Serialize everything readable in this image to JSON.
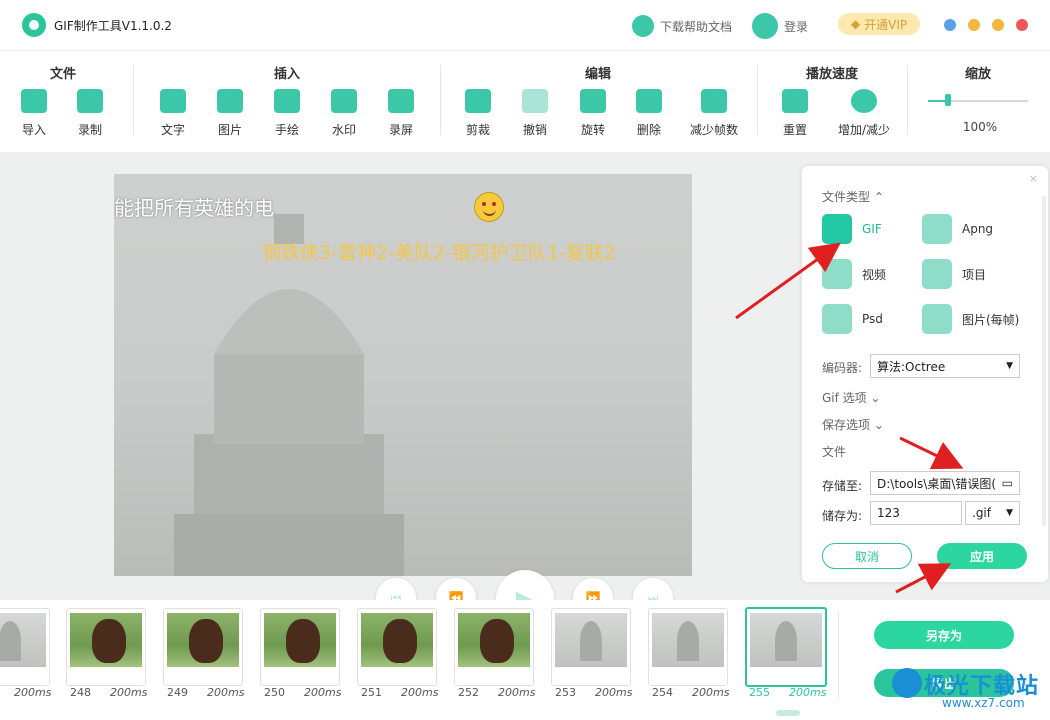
{
  "app": {
    "title": "GIF制作工具V1.1.0.2",
    "help": "下载帮助文档",
    "login": "登录",
    "vip": "开通VIP"
  },
  "toolbar": {
    "groups": [
      {
        "title": "文件",
        "items": [
          "导入",
          "录制"
        ]
      },
      {
        "title": "插入",
        "items": [
          "文字",
          "图片",
          "手绘",
          "水印",
          "录屏"
        ]
      },
      {
        "title": "编辑",
        "items": [
          "剪裁",
          "撤销",
          "旋转",
          "删除",
          "减少帧数"
        ]
      },
      {
        "title": "播放速度",
        "items": [
          "重置",
          "增加/减少"
        ]
      },
      {
        "title": "缩放",
        "items": []
      }
    ],
    "zoom": {
      "value": "100%",
      "level": 0.2
    }
  },
  "canvas": {
    "text1": "能把所有英雄的电",
    "text2": "钢铁侠3-雷神2-美队2-银河护卫队1-复联2"
  },
  "panel": {
    "file_type_label": "文件类型",
    "types": [
      "GIF",
      "Apng",
      "视频",
      "项目",
      "Psd",
      "图片(每帧)"
    ],
    "selected_type": "GIF",
    "encoder_label": "编码器:",
    "encoder_value": "算法:Octree",
    "gif_options": "Gif 选项",
    "save_options": "保存选项",
    "file_label": "文件",
    "save_to_label": "存储至:",
    "save_to_value": "D:\\tools\\桌面\\错误图(",
    "save_as_label": "储存为:",
    "save_as_value": "123",
    "ext_value": ".gif",
    "cancel": "取消",
    "apply": "应用"
  },
  "frames": [
    {
      "num": "",
      "dur": "200ms",
      "kind": "capitol"
    },
    {
      "num": "248",
      "dur": "200ms",
      "kind": "face"
    },
    {
      "num": "249",
      "dur": "200ms",
      "kind": "face"
    },
    {
      "num": "250",
      "dur": "200ms",
      "kind": "face"
    },
    {
      "num": "251",
      "dur": "200ms",
      "kind": "face"
    },
    {
      "num": "252",
      "dur": "200ms",
      "kind": "face"
    },
    {
      "num": "253",
      "dur": "200ms",
      "kind": "capitol"
    },
    {
      "num": "254",
      "dur": "200ms",
      "kind": "capitol"
    },
    {
      "num": "255",
      "dur": "200ms",
      "kind": "capitol",
      "selected": true
    }
  ],
  "actions": {
    "save_as": "另存为",
    "export": "导出"
  },
  "watermark": {
    "line1": "极光下载站",
    "line2": "www.xz7.com"
  },
  "colors": {
    "accent": "#2bc59c",
    "arrow": "#e02020",
    "overlay_text": "#f2c54b"
  }
}
